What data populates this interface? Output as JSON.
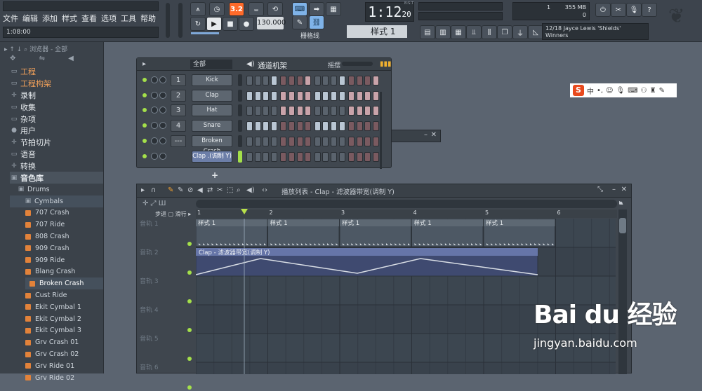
{
  "menu": [
    "文件",
    "编辑",
    "添加",
    "样式",
    "查看",
    "选项",
    "工具",
    "帮助"
  ],
  "hint_line": "1:08:00",
  "toolbar": {
    "pattern_mode": "Pat",
    "song_mode": "Song",
    "tempo": "130.000",
    "snap_label": "栅格线",
    "pattern_value": "样式 1",
    "countdown_value": "3.2",
    "accent": "#ff6a2a"
  },
  "clock": {
    "time": "1:12",
    "frac": "20",
    "label": "B:S:T"
  },
  "cpu": {
    "cpu_value": "1",
    "mem_value": "355 MB",
    "poly_value": "0"
  },
  "song_hint": {
    "line1": "12/18  Jayce Lewis 'Shields'",
    "line2": "Winners"
  },
  "browser": {
    "header": "浏览器 - 全部",
    "items": [
      {
        "label": "工程",
        "icon": "folder-icon",
        "style": "orange"
      },
      {
        "label": "工程构架",
        "icon": "folder-icon",
        "style": "orange"
      },
      {
        "label": "录制",
        "icon": "record-icon",
        "style": "normal"
      },
      {
        "label": "收集",
        "icon": "folder-icon",
        "style": "normal"
      },
      {
        "label": "杂项",
        "icon": "folder-icon",
        "style": "normal"
      },
      {
        "label": "用户",
        "icon": "user-icon",
        "style": "normal"
      },
      {
        "label": "节拍切片",
        "icon": "slice-icon",
        "style": "normal"
      },
      {
        "label": "语音",
        "icon": "folder-icon",
        "style": "normal"
      },
      {
        "label": "转换",
        "icon": "convert-icon",
        "style": "normal"
      }
    ],
    "library": {
      "label": "音色库"
    },
    "drums": {
      "label": "Drums"
    },
    "cymbals": {
      "label": "Cymbals"
    },
    "samples": [
      "707 Crash",
      "707 Ride",
      "808 Crash",
      "909 Crash",
      "909 Ride",
      "Blang Crash",
      "Broken Crash",
      "Cust Ride",
      "Ekit Cymbal 1",
      "Ekit Cymbal 2",
      "Ekit Cymbal 3",
      "Grv Crash 01",
      "Grv Crash 02",
      "Grv Ride 01",
      "Grv Ride 02"
    ],
    "selected_sample": "Broken Crash"
  },
  "channel_rack": {
    "title": "通道机架",
    "filter": "全部",
    "swing_label": "摇摆",
    "add_label": "+",
    "channels": [
      {
        "num": "1",
        "name": "Kick",
        "steps": [
          0,
          0,
          0,
          1,
          0,
          0,
          0,
          1,
          0,
          0,
          0,
          1,
          0,
          0,
          0,
          1
        ]
      },
      {
        "num": "2",
        "name": "Clap",
        "steps": [
          1,
          1,
          1,
          1,
          1,
          1,
          1,
          1,
          1,
          1,
          1,
          1,
          1,
          1,
          1,
          1
        ]
      },
      {
        "num": "3",
        "name": "Hat",
        "steps": [
          0,
          0,
          0,
          0,
          1,
          1,
          1,
          1,
          0,
          0,
          0,
          0,
          1,
          1,
          1,
          1
        ]
      },
      {
        "num": "4",
        "name": "Snare",
        "steps": [
          1,
          1,
          1,
          1,
          0,
          0,
          0,
          0,
          1,
          1,
          1,
          1,
          0,
          0,
          0,
          0
        ]
      },
      {
        "num": "---",
        "name": "Broken Crash",
        "steps": [
          0,
          0,
          0,
          0,
          0,
          0,
          0,
          0,
          0,
          0,
          0,
          0,
          0,
          0,
          0,
          0
        ]
      },
      {
        "num": "",
        "name": "Clap .(调制 Y)",
        "steps": [
          0,
          0,
          0,
          0,
          0,
          0,
          0,
          0,
          0,
          0,
          0,
          0,
          0,
          0,
          0,
          0
        ]
      }
    ],
    "step_on_color": "#b9c6d3",
    "step_pink_color": "#c9a3aa"
  },
  "playlist": {
    "title": "播放列表 - Clap - 滤波器带宽(调制 Y)",
    "step_label": "步进",
    "slide_label": "滑行",
    "ruler": [
      "1",
      "2",
      "3",
      "4",
      "5",
      "6"
    ],
    "tracks": [
      "音轨 1",
      "音轨 2",
      "音轨 3",
      "音轨 4",
      "音轨 5",
      "音轨 6"
    ],
    "pattern_clips": [
      "样式 1",
      "样式 1",
      "样式 1",
      "样式 1",
      "样式 1"
    ],
    "automation_clip": "Clap - 滤波器带宽(调制 Y)"
  },
  "ime": {
    "label": "中"
  },
  "watermark": {
    "logo": "Bai du 经验",
    "url": "jingyan.baidu.com"
  }
}
